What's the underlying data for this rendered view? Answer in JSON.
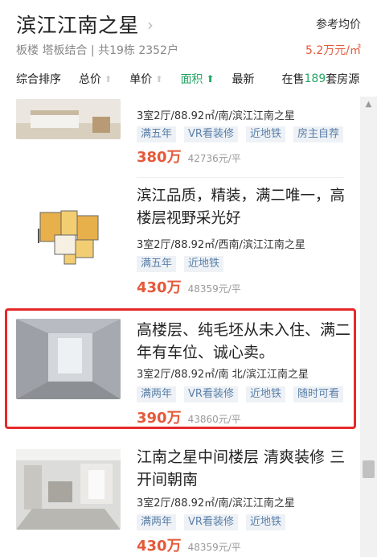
{
  "header": {
    "title": "滨江江南之星",
    "chevron": "›",
    "subinfo": "板楼 塔板结合 | 共19栋 2352户",
    "ref_price_label": "参考均价",
    "ref_price": "5.2万元/㎡"
  },
  "sortbar": {
    "items": [
      {
        "label": "综合排序",
        "arrow": ""
      },
      {
        "label": "总价",
        "arrow": "⬆"
      },
      {
        "label": "单价",
        "arrow": "⬆"
      },
      {
        "label": "面积",
        "arrow": "⬆",
        "active": true
      },
      {
        "label": "最新",
        "arrow": ""
      }
    ],
    "count_prefix": "在售",
    "count": "189",
    "count_suffix": "套房源"
  },
  "listings": [
    {
      "title": "",
      "meta": "3室2厅/88.92㎡/南/滨江江南之星",
      "tags": [
        "满五年",
        "VR看装修",
        "近地铁",
        "房主自荐"
      ],
      "price": "380万",
      "unit_price": "42736元/平"
    },
    {
      "title": "滨江品质，精装，满二唯一，高楼层视野采光好",
      "meta": "3室2厅/88.92㎡/西南/滨江江南之星",
      "tags": [
        "满五年",
        "近地铁"
      ],
      "price": "430万",
      "unit_price": "48359元/平"
    },
    {
      "title": "高楼层、纯毛坯从未入住、满二年有车位、诚心卖。",
      "meta": "3室2厅/88.92㎡/南 北/滨江江南之星",
      "tags": [
        "满两年",
        "VR看装修",
        "近地铁",
        "随时可看"
      ],
      "price": "390万",
      "unit_price": "43860元/平"
    },
    {
      "title": "江南之星中间楼层 清爽装修 三开间朝南",
      "meta": "3室2厅/88.92㎡/南/滨江江南之星",
      "tags": [
        "满两年",
        "VR看装修",
        "近地铁"
      ],
      "price": "430万",
      "unit_price": "48359元/平"
    }
  ],
  "icons": {
    "scroll_up": "scroll-up-arrow-icon",
    "sort_arrow": "arrow-up-icon"
  },
  "colors": {
    "accent_green": "#27a565",
    "price_red": "#e4593a",
    "highlight_red": "#e62a2a",
    "tag_blue": "#5a7fa8"
  }
}
